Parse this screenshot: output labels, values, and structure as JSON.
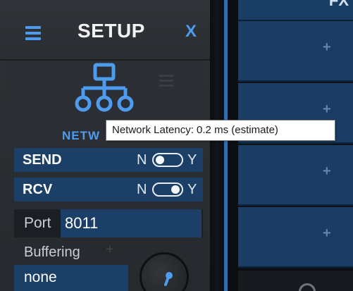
{
  "setup": {
    "title": "SETUP",
    "close_label": "X",
    "network": {
      "label": "NETW"
    },
    "send": {
      "label": "SEND",
      "off_label": "N",
      "on_label": "Y",
      "enabled": false
    },
    "rcv": {
      "label": "RCV",
      "off_label": "N",
      "on_label": "Y",
      "enabled": true
    },
    "port": {
      "label": "Port",
      "value": "8011"
    },
    "buffering": {
      "label": "Buffering",
      "plus": "+",
      "value": "none"
    }
  },
  "tooltip": {
    "text": "Network Latency: 0.2 ms (estimate)"
  },
  "channel_strip": {
    "top_text": "FX",
    "slots": [
      "+",
      "+",
      "+",
      "+"
    ]
  },
  "colors": {
    "accent": "#4d9cf0",
    "row_bg": "#1c3f67",
    "panel_bg": "#2b2e32"
  },
  "icons": {
    "menu": "hamburger-menu-icon",
    "network": "network-hierarchy-icon",
    "close": "close-x"
  }
}
